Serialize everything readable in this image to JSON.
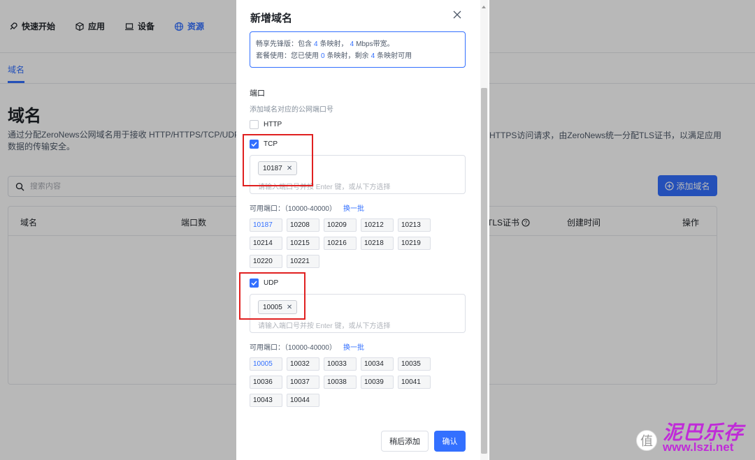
{
  "nav": {
    "items": [
      {
        "label": "快速开始",
        "icon": "rocket-icon"
      },
      {
        "label": "应用",
        "icon": "cube-icon"
      },
      {
        "label": "设备",
        "icon": "laptop-icon"
      },
      {
        "label": "资源",
        "icon": "globe-icon",
        "active": true
      }
    ]
  },
  "subtabs": {
    "domain": "域名"
  },
  "page": {
    "title": "域名",
    "desc_line1": "通过分配ZeroNews公网域名用于接收 HTTP/HTTPS/TCP/UDP的",
    "desc_line1_right": "HTTPS访问请求，由ZeroNews统一分配TLS证书，以满足应用",
    "desc_line2": "数据的传输安全。",
    "search_placeholder": "搜索内容",
    "add_button": "添加域名"
  },
  "table": {
    "col_domain": "域名",
    "col_ports": "端口数",
    "col_tls": "TLS证书",
    "col_created": "创建时间",
    "col_actions": "操作"
  },
  "modal": {
    "title": "新增域名",
    "info": {
      "line1_prefix": "畅享先锋版：包含",
      "line1_count": "4",
      "line1_mid": "条映射，",
      "line1_bw": "4",
      "line1_suffix": "Mbps带宽。",
      "line2_prefix": "套餐使用：您已使用",
      "line2_used": "0",
      "line2_mid": "条映射，剩余",
      "line2_left": "4",
      "line2_suffix": "条映射可用"
    },
    "section_label": "端口",
    "section_hint": "添加域名对应的公网端口号",
    "http_label": "HTTP",
    "tcp": {
      "label": "TCP",
      "tag": "10187",
      "placeholder": "请输入端口号并按 Enter 键，或从下方选择",
      "avail_label": "可用端口：（10000-40000）",
      "refresh": "换一批",
      "ports": [
        "10187",
        "10208",
        "10209",
        "10212",
        "10213",
        "10214",
        "10215",
        "10216",
        "10218",
        "10219",
        "10220",
        "10221"
      ]
    },
    "udp": {
      "label": "UDP",
      "tag": "10005",
      "placeholder": "请输入端口号并按 Enter 键，或从下方选择",
      "avail_label": "可用端口：（10000-40000）",
      "refresh": "换一批",
      "ports": [
        "10005",
        "10032",
        "10033",
        "10034",
        "10035",
        "10036",
        "10037",
        "10038",
        "10039",
        "10041",
        "10043",
        "10044"
      ]
    },
    "btn_later": "稍后添加",
    "btn_ok": "确认"
  },
  "watermark": {
    "zhi": "值",
    "text": "泥巴乐存",
    "url": "www.lszi.net"
  },
  "colors": {
    "accent": "#3370ff",
    "highlight": "#e02020",
    "watermark": "#c02bd8"
  }
}
